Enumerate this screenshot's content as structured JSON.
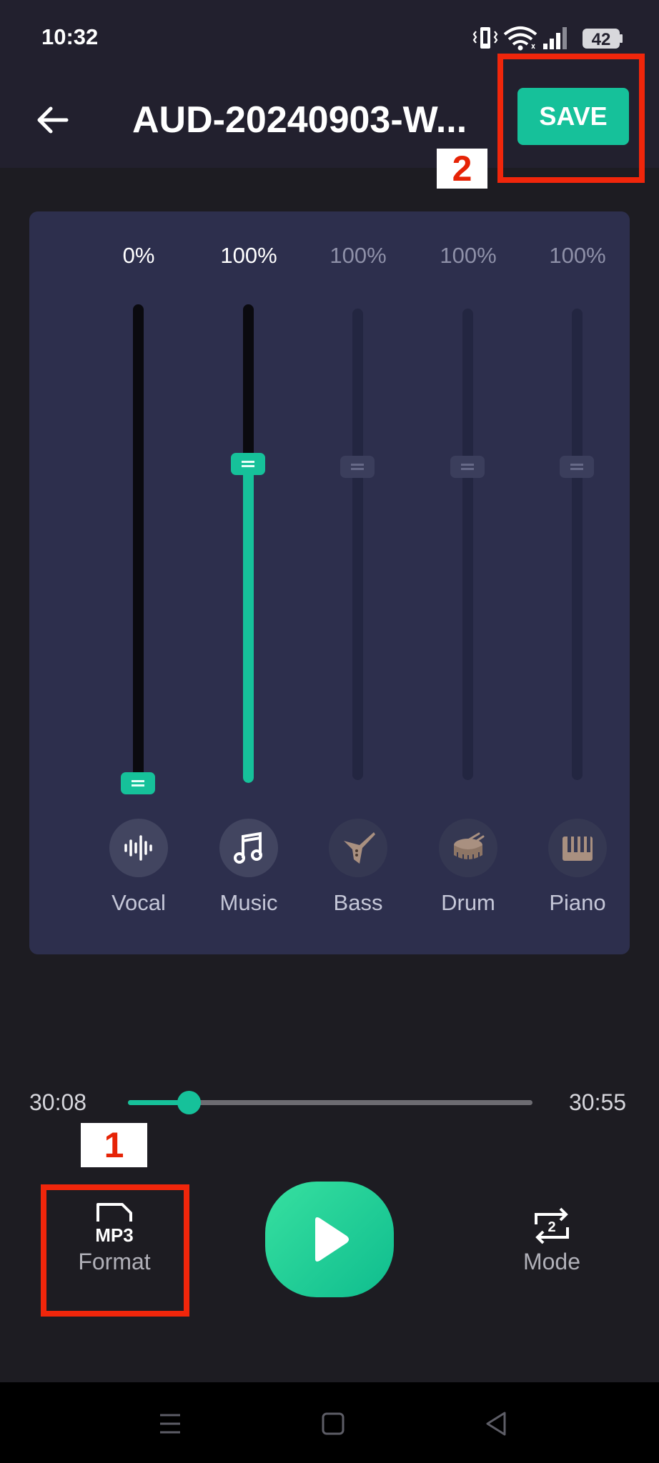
{
  "status_bar": {
    "time": "10:32",
    "battery": "42",
    "icons": [
      "vibrate-icon",
      "wifi-icon",
      "signal-icon",
      "battery-icon"
    ]
  },
  "header": {
    "title": "AUD-20240903-W...",
    "save_label": "SAVE",
    "back_icon": "arrow-left-icon"
  },
  "annotations": [
    {
      "label": "1",
      "target": "format-button",
      "color": "#f0260b"
    },
    {
      "label": "2",
      "target": "save-button",
      "color": "#f0260b"
    }
  ],
  "mixer": {
    "channels": [
      {
        "name": "Vocal",
        "percent": "0%",
        "level": 0.0,
        "enabled": true,
        "icon": "waveform-icon"
      },
      {
        "name": "Music",
        "percent": "100%",
        "level": 0.67,
        "enabled": true,
        "icon": "music-note-icon"
      },
      {
        "name": "Bass",
        "percent": "100%",
        "level": 0.67,
        "enabled": false,
        "icon": "guitar-icon"
      },
      {
        "name": "Drum",
        "percent": "100%",
        "level": 0.67,
        "enabled": false,
        "icon": "drum-icon"
      },
      {
        "name": "Piano",
        "percent": "100%",
        "level": 0.67,
        "enabled": false,
        "icon": "piano-icon"
      }
    ]
  },
  "player": {
    "current_time": "30:08",
    "total_time": "30:55",
    "progress": 0.15,
    "format_icon_text": "MP3",
    "format_label": "Format",
    "mode_icon_text": "2",
    "mode_label": "Mode"
  },
  "nav": {
    "icons": [
      "menu-icon",
      "home-icon",
      "back-triangle-icon"
    ]
  },
  "colors": {
    "accent": "#16c19a",
    "panel": "#2d2f4d",
    "background": "#1d1c22",
    "header": "#22202e",
    "annotation": "#f0260b"
  }
}
